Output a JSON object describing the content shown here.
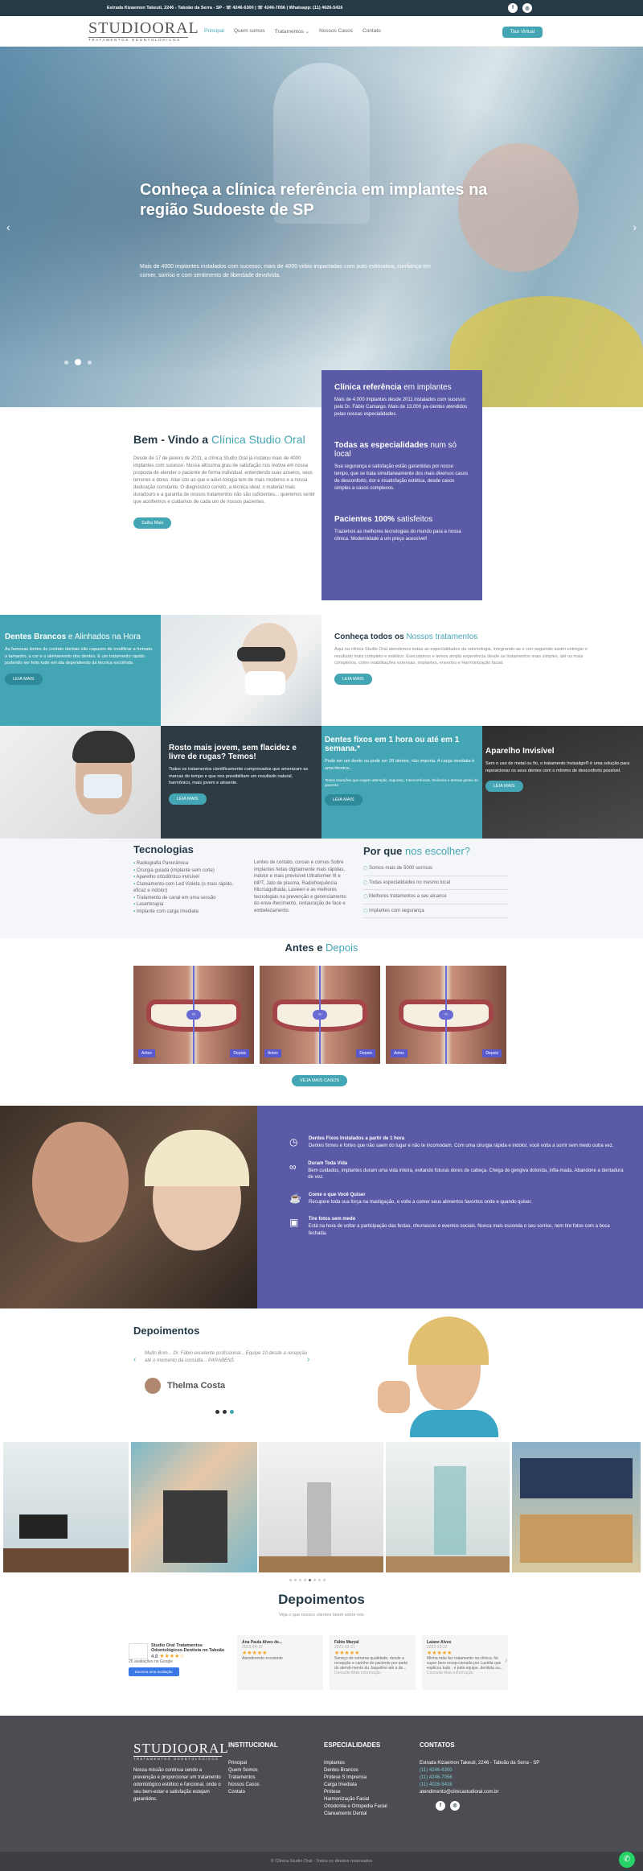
{
  "topbar": {
    "text": "Estrada Kizaemon Takeuti, 2246 - Taboão da Serra - SP - ☏ 4246-6300 | ☏ 4246-7056 | Whatsapp: (11) 4026-5416"
  },
  "logo": {
    "name": "STUDIOORAL",
    "tagline": "TRATAMENTOS ODONTOLÓGICOS"
  },
  "nav": {
    "items": [
      "Principal",
      "Quem somos",
      "Tratamentos ⌄",
      "Nossos Casos",
      "Contato"
    ],
    "button": "Tour Virtual"
  },
  "hero": {
    "title": "Conheça a clínica referência em implantes na região Sudoeste de SP",
    "text": "Mais de 4000 implantes instalados com sucesso; mais de 4000 vidas impactadas com auto estimativa, confiança em comer, sorriso e com sentimento de liberdade devolvida."
  },
  "welcome": {
    "title_a": "Bem - Vindo a ",
    "title_b": "Clínica Studio Oral",
    "text": "Desde de 17 de janeiro de 2011, a clínica Studio Oral já instalou mais de 4000 implantes com sucesso. Nossa altíssima grau de satisfação nos motiva em nossa proposta de atender o paciente de forma individual, entendendo suas anseios, seus temores e dores. Aliar isto ao que e adon-tologia tem de mais moderno e a nossa dedicação constante. O diagnóstico correto, a técnica ideal, o material mais duradouro e a garantia de nossos tratamentos não são suficientes... queremos sentir que acolhemos e cuidamos de cada um de nossos pacientes.",
    "button": "Saiba Mais"
  },
  "purple": {
    "h1a": "Clínica referência",
    "h1b": " em implantes",
    "p1": "Mais de 4.000 implantes desde 2011 instalados com sucesso pelo Dr. Fábio Camargo. Mais de 13.000 pa-cientes atendidos pelas nossas especialidades.",
    "h2a": "Todas as especialidades",
    "h2b": " num só local",
    "p2": "Sua segurança e satisfação estão garantidas por nosso tempo, que se trata simultaneamente dos mais diversos casos de desconforto, dor e insatisfação estética, desde casos simples a casos complexos.",
    "h3a": "Pacientes 100%",
    "h3b": " satisfeitos",
    "p3": "Trazemos as melhores tecnologias do mundo para a nossa clínica. Modernidade a um preço acessível!"
  },
  "grid": {
    "c1": {
      "ta": "Dentes Brancos",
      "tb": " e Alinhados na Hora",
      "p": "As famosas lentes de contato dentais são capazes de modificar a formato, o tamanho, a cor e o alinhamento dos dentes. E um tratamento rápido podendo ser feito tudo em dia dependendo da técnica escolhida.",
      "b": "LEIA MAIS"
    },
    "c2": {
      "ta": "Conheça todos os",
      "tb": " Nossos tratamentos",
      "p": "Aqui na clínica Studio Oral atendemos todas as especialidades da odontologia, integrando-as e con-seguindo assim entregar o resultado mais completo e estético. Executamos e temos ampla experiência desde os tratamentos mais simples, até os mais complexos, como reabilitações extensas, implantes, enxertos e Harmonização facial.",
      "b": "LEIA MAIS"
    },
    "c3": {
      "t": "Rosto mais jovem, sem flacidez e livre de rugas? Temos!",
      "p": "Todos os tratamentos cientificamente comprovados que amenizam as marcas do tempo e que nos possibilitam um resultado natural, harmônico, mais jovem e atraente.",
      "b": "LEIA MAIS"
    },
    "c4": {
      "t": "Dentes fixos em 1 hora ou até em 1 semana.*",
      "p": "Pode ser um dente ou pode ser 28 dentes, não importa. A carga imediata é uma técnica...",
      "n": "*Estas situações que exigem alteração, seguranç, Intercorrências, fenômica e demais gerais do paciente.",
      "b": "LEIA MAIS"
    },
    "c5": {
      "t": "Aparelho Invisível",
      "p": "Sem o uso de metal ou fio, o tratamento Invisalign® é uma solução para reposicionar os seus dentes com o mínimo de desconforto possível.",
      "b": "LEIA MAIS"
    }
  },
  "tech": {
    "title": "Tecnologias",
    "left": [
      "Radiografia Panorâmica",
      "Cirurgia guiada (implante sem corte)",
      "Aparelho ortodôntico invisível",
      "Clareamento com Led Violeta (o mais rápido, eficaz e indolor)",
      "Tratamento de canal em uma sessão",
      "Laserterapia",
      "Implante com carga imediata"
    ],
    "right": "Lentes de contato, coroas e cornas Sobre implantes feitas digitalmente mais rápidas, indolor e mais previsível Ultraformer III e MPT, Jato de plasma, Radiofrequência Microagulhada, Lavieen e as melhores tecnologias na prevenção e gerenciamento do enve-lhecimento, restauração de face e embelezamento.",
    "why_a": "Por que ",
    "why_b": "nos escolher?",
    "why": [
      "Somos mais de 5000 sorrisos",
      "Todas especialidades no mesmo local",
      "Melhores tratamentos a seu alcance",
      "Implantes com segurança"
    ]
  },
  "ba": {
    "ta": "Antes e ",
    "tb": "Depois",
    "antes": "Antes",
    "depois": "Depois",
    "button": "VEJA MAIS CASOS"
  },
  "benefits": [
    {
      "icon": "clock-icon",
      "sym": "◷",
      "h": "Dentes Fixos Instalados a partir de 1 hora",
      "p": "Dentes firmes e fortes que não saem do lugar e não te incomodam. Com uma cirurgia rápida e indolor, você volta a sorrir sem medo outra vez."
    },
    {
      "icon": "infinity-icon",
      "sym": "∞",
      "h": "Duram Toda Vida",
      "p": "Bem cuidados, implantes duram uma vida inteira, evitando futuras dores de cabeça. Chega de gengiva dolorida, infla-mada. Abandone a dentadura de vez."
    },
    {
      "icon": "food-icon",
      "sym": "☕",
      "h": "Come o que Você Quiser",
      "p": "Recupere toda sua força na mastigação, e volte a comer seus alimentos favoritos onde e quando quiser."
    },
    {
      "icon": "photo-icon",
      "sym": "▣",
      "h": "Tire fotos sem medo",
      "p": "Está na hora de voltar a participação das festas, churrascos e eventos sociais. Nunca mais esconda o seu sorriso, nem tire fotos com a boca fechada."
    }
  ],
  "depo": {
    "title": "Depoimentos",
    "quote": "Muito Bom... Dr. Fábio excelente profissional... Equipe 10 desde a recepção até o momento da consulta... PARABENS",
    "name": "Thelma Costa"
  },
  "reviews": {
    "title": "Depoimentos",
    "sub": "Veja o que nossos clientes falam sobre nós",
    "biz": "Studio Oral Tratamentos Odontológicos-Dentista no Taboão",
    "count": "26 avaliações no Google",
    "write": "Escreva uma avaliação",
    "cards": [
      {
        "n": "Ana Paula Alves de...",
        "d": "2023-04-19",
        "t": "Atendimento excelente"
      },
      {
        "n": "Fábio Maryal",
        "d": "2023-03-31",
        "t": "Serviço de extrema qualidade, desde a recepção e carinho do paciente por parte do atendi-mento da Jaqueline até a de...",
        "m": "Consulte Mais informação"
      },
      {
        "n": "Laiane Alves",
        "d": "2023-03-22",
        "t": "Minha mãe fez tratamento na clínica, foi super bem recep-cionada por Luzélia que explicou tudo , e pela equipe, dentista su...",
        "m": "Consulte Mais informação"
      }
    ],
    "rating": "4.8"
  },
  "footer": {
    "mission": "Nossa missão continua sendo a prevenção e proporcionar um tratamento odontológico estético e funcional, onde o seu bem-estar e satisfação estejam garantidos.",
    "inst_t": "INSTITUCIONAL",
    "inst": [
      "Principal",
      "Quem Somos",
      "Tratamentos",
      "Nossos Casos",
      "Contato"
    ],
    "esp_t": "ESPECIALIDADES",
    "esp": [
      "Implantes",
      "Dentes Brancos",
      "Prótese S Imprensa",
      "Carga Imediata",
      "Prótese",
      "Harmonização Facial",
      "Ortodontia e Ortopedia Facial",
      "Clareamento Dental"
    ],
    "con_t": "CONTATOS",
    "addr": "Estrada Kizaemon Takeuti, 2246 - Taboão da Serra - SP",
    "ph1": "(11) 4246-6300",
    "ph2": "(11) 4246-7056",
    "ph3": "(11) 4026-5416",
    "mail": "atendimento@clinicastudioral.com.br",
    "copy": "© Clínica Studio Oral - Todos os direitos reservados"
  },
  "colors": {
    "teal": "#44a6b4",
    "purple": "#5a5aa7",
    "navy": "#253a47",
    "dark": "#2e3b44"
  }
}
